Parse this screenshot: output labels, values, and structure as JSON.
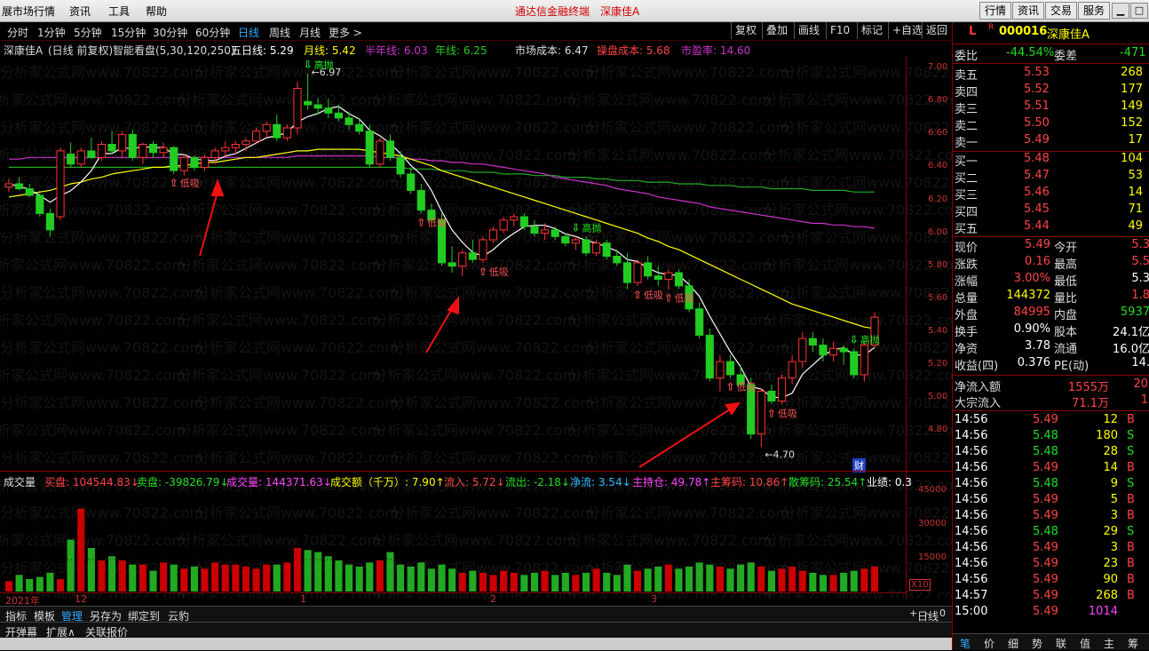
{
  "menubar": {
    "items": [
      "展市场行情",
      "资讯",
      "工具",
      "帮助"
    ],
    "title": "通达信金融终端",
    "stock_title": "深康佳A",
    "buttons": [
      "行情",
      "资讯",
      "交易",
      "服务"
    ],
    "window_controls": [
      "▁",
      "□",
      "✕"
    ]
  },
  "periodbar": {
    "periods": [
      "分时",
      "1分钟",
      "5分钟",
      "15分钟",
      "30分钟",
      "60分钟",
      "日线",
      "周线",
      "月线",
      "更多 >"
    ],
    "active": "日线",
    "tools": [
      "复权",
      "叠加",
      "画线",
      "F10",
      "标记",
      "+自选",
      "返回"
    ]
  },
  "infoline": {
    "name": "深康佳A",
    "mode": "(日线 前复权)",
    "indicator": "智能看盘(5,30,120,250)",
    "ma5": "五日线: 5.29",
    "ma_month": "月线: 5.42",
    "ma_halfyear": "半年线: 6.03",
    "ma_year": "年线: 6.25",
    "market_cost": "市场成本: 6.47",
    "op_cost": "操盘成本: 5.68",
    "pe": "市盈率: 14.60"
  },
  "colors": {
    "up": "#ff3333",
    "down": "#22cc22",
    "ma5": "#ffffff",
    "ma30": "#ffff00",
    "ma120": "#ee3322",
    "ma250": "#cc33cc",
    "market": "#22aa22"
  },
  "chart_data": {
    "type": "candlestick",
    "ylim": [
      4.6,
      7.05
    ],
    "y_ticks": [
      "7.00",
      "6.80",
      "6.60",
      "6.40",
      "6.20",
      "6.00",
      "5.80",
      "5.60",
      "5.40",
      "5.20",
      "5.00",
      "4.80"
    ],
    "candles": [
      [
        6.28,
        6.33,
        6.25,
        6.3
      ],
      [
        6.3,
        6.34,
        6.26,
        6.27
      ],
      [
        6.27,
        6.3,
        6.22,
        6.23
      ],
      [
        6.23,
        6.26,
        6.1,
        6.12
      ],
      [
        6.12,
        6.15,
        5.98,
        6.02
      ],
      [
        6.1,
        6.52,
        6.08,
        6.5
      ],
      [
        6.48,
        6.55,
        6.4,
        6.42
      ],
      [
        6.42,
        6.52,
        6.4,
        6.5
      ],
      [
        6.5,
        6.58,
        6.45,
        6.46
      ],
      [
        6.46,
        6.56,
        6.44,
        6.54
      ],
      [
        6.54,
        6.62,
        6.48,
        6.5
      ],
      [
        6.5,
        6.62,
        6.46,
        6.6
      ],
      [
        6.6,
        6.63,
        6.44,
        6.46
      ],
      [
        6.46,
        6.55,
        6.42,
        6.54
      ],
      [
        6.54,
        6.56,
        6.46,
        6.49
      ],
      [
        6.49,
        6.55,
        6.46,
        6.52
      ],
      [
        6.52,
        6.53,
        6.36,
        6.38
      ],
      [
        6.38,
        6.48,
        6.35,
        6.46
      ],
      [
        6.46,
        6.47,
        6.38,
        6.4
      ],
      [
        6.4,
        6.48,
        6.38,
        6.46
      ],
      [
        6.46,
        6.52,
        6.42,
        6.5
      ],
      [
        6.5,
        6.56,
        6.46,
        6.52
      ],
      [
        6.52,
        6.56,
        6.48,
        6.54
      ],
      [
        6.54,
        6.58,
        6.5,
        6.56
      ],
      [
        6.56,
        6.64,
        6.54,
        6.62
      ],
      [
        6.62,
        6.68,
        6.58,
        6.66
      ],
      [
        6.66,
        6.72,
        6.56,
        6.58
      ],
      [
        6.58,
        6.66,
        6.56,
        6.64
      ],
      [
        6.64,
        6.92,
        6.6,
        6.88
      ],
      [
        6.8,
        6.97,
        6.75,
        6.78
      ],
      [
        6.78,
        6.82,
        6.72,
        6.76
      ],
      [
        6.76,
        6.82,
        6.7,
        6.73
      ],
      [
        6.73,
        6.78,
        6.68,
        6.7
      ],
      [
        6.7,
        6.74,
        6.63,
        6.66
      ],
      [
        6.66,
        6.7,
        6.6,
        6.62
      ],
      [
        6.62,
        6.66,
        6.4,
        6.42
      ],
      [
        6.42,
        6.58,
        6.4,
        6.56
      ],
      [
        6.56,
        6.6,
        6.44,
        6.46
      ],
      [
        6.46,
        6.5,
        6.34,
        6.36
      ],
      [
        6.36,
        6.4,
        6.24,
        6.26
      ],
      [
        6.26,
        6.3,
        6.12,
        6.14
      ],
      [
        6.14,
        6.18,
        6.06,
        6.08
      ],
      [
        6.08,
        6.12,
        5.8,
        5.82
      ],
      [
        5.82,
        5.92,
        5.76,
        5.8
      ],
      [
        5.8,
        5.9,
        5.74,
        5.88
      ],
      [
        5.88,
        5.96,
        5.82,
        5.84
      ],
      [
        5.84,
        5.98,
        5.82,
        5.96
      ],
      [
        5.96,
        6.04,
        5.94,
        6.02
      ],
      [
        6.02,
        6.1,
        6.0,
        6.08
      ],
      [
        6.08,
        6.12,
        6.04,
        6.1
      ],
      [
        6.1,
        6.12,
        6.02,
        6.04
      ],
      [
        6.04,
        6.08,
        5.98,
        6.0
      ],
      [
        6.0,
        6.06,
        5.96,
        6.02
      ],
      [
        6.02,
        6.04,
        5.96,
        5.98
      ],
      [
        5.98,
        6.0,
        5.92,
        5.94
      ],
      [
        5.94,
        5.98,
        5.9,
        5.96
      ],
      [
        5.96,
        5.98,
        5.86,
        5.88
      ],
      [
        5.88,
        5.96,
        5.86,
        5.94
      ],
      [
        5.94,
        5.96,
        5.84,
        5.86
      ],
      [
        5.86,
        5.9,
        5.8,
        5.82
      ],
      [
        5.82,
        5.88,
        5.66,
        5.7
      ],
      [
        5.7,
        5.84,
        5.68,
        5.82
      ],
      [
        5.82,
        5.86,
        5.72,
        5.74
      ],
      [
        5.74,
        5.8,
        5.68,
        5.72
      ],
      [
        5.72,
        5.78,
        5.66,
        5.76
      ],
      [
        5.76,
        5.78,
        5.66,
        5.68
      ],
      [
        5.68,
        5.72,
        5.52,
        5.54
      ],
      [
        5.54,
        5.58,
        5.36,
        5.38
      ],
      [
        5.38,
        5.42,
        5.1,
        5.12
      ],
      [
        5.12,
        5.26,
        5.04,
        5.22
      ],
      [
        5.22,
        5.26,
        5.12,
        5.14
      ],
      [
        5.14,
        5.2,
        5.06,
        5.08
      ],
      [
        5.08,
        5.12,
        4.75,
        4.78
      ],
      [
        4.78,
        5.06,
        4.7,
        5.04
      ],
      [
        5.04,
        5.08,
        4.96,
        4.98
      ],
      [
        4.98,
        5.14,
        4.96,
        5.12
      ],
      [
        5.12,
        5.26,
        5.08,
        5.22
      ],
      [
        5.22,
        5.4,
        5.18,
        5.36
      ],
      [
        5.36,
        5.4,
        5.28,
        5.32
      ],
      [
        5.32,
        5.36,
        5.22,
        5.26
      ],
      [
        5.26,
        5.34,
        5.22,
        5.3
      ],
      [
        5.3,
        5.32,
        5.2,
        5.28
      ],
      [
        5.28,
        5.3,
        5.12,
        5.14
      ],
      [
        5.14,
        5.34,
        5.1,
        5.32
      ],
      [
        5.32,
        5.52,
        5.3,
        5.49
      ]
    ],
    "ma_month": [
      6.22,
      6.23,
      6.24,
      6.25,
      6.26,
      6.28,
      6.3,
      6.31,
      6.33,
      6.34,
      6.36,
      6.37,
      6.38,
      6.39,
      6.4,
      6.4,
      6.41,
      6.41,
      6.42,
      6.43,
      6.43,
      6.44,
      6.45,
      6.46,
      6.46,
      6.47,
      6.48,
      6.49,
      6.5,
      6.5,
      6.51,
      6.51,
      6.51,
      6.51,
      6.51,
      6.5,
      6.49,
      6.48,
      6.47,
      6.45,
      6.43,
      6.41,
      6.38,
      6.36,
      6.34,
      6.32,
      6.3,
      6.28,
      6.26,
      6.24,
      6.22,
      6.2,
      6.18,
      6.16,
      6.14,
      6.12,
      6.1,
      6.08,
      6.06,
      6.04,
      6.02,
      6.0,
      5.97,
      5.95,
      5.92,
      5.9,
      5.87,
      5.84,
      5.81,
      5.78,
      5.75,
      5.72,
      5.69,
      5.66,
      5.63,
      5.6,
      5.57,
      5.55,
      5.53,
      5.51,
      5.49,
      5.47,
      5.45,
      5.43,
      5.42
    ],
    "ma_halfyear": [
      6.45,
      6.45,
      6.46,
      6.46,
      6.46,
      6.46,
      6.46,
      6.46,
      6.46,
      6.46,
      6.46,
      6.46,
      6.46,
      6.46,
      6.46,
      6.46,
      6.46,
      6.46,
      6.46,
      6.46,
      6.46,
      6.46,
      6.46,
      6.46,
      6.46,
      6.46,
      6.46,
      6.46,
      6.47,
      6.47,
      6.47,
      6.47,
      6.47,
      6.47,
      6.47,
      6.47,
      6.46,
      6.46,
      6.46,
      6.45,
      6.45,
      6.44,
      6.44,
      6.43,
      6.43,
      6.42,
      6.42,
      6.41,
      6.4,
      6.39,
      6.38,
      6.37,
      6.36,
      6.34,
      6.33,
      6.32,
      6.31,
      6.3,
      6.29,
      6.27,
      6.26,
      6.25,
      6.24,
      6.22,
      6.21,
      6.2,
      6.19,
      6.18,
      6.16,
      6.15,
      6.14,
      6.13,
      6.12,
      6.11,
      6.1,
      6.09,
      6.08,
      6.07,
      6.06,
      6.06,
      6.05,
      6.05,
      6.04,
      6.04,
      6.03
    ],
    "ma_year": [
      6.4,
      6.4,
      6.4,
      6.4,
      6.4,
      6.4,
      6.4,
      6.4,
      6.4,
      6.4,
      6.4,
      6.4,
      6.4,
      6.4,
      6.4,
      6.4,
      6.4,
      6.4,
      6.4,
      6.4,
      6.4,
      6.4,
      6.4,
      6.4,
      6.4,
      6.4,
      6.4,
      6.4,
      6.4,
      6.4,
      6.4,
      6.4,
      6.4,
      6.4,
      6.4,
      6.4,
      6.4,
      6.4,
      6.4,
      6.39,
      6.39,
      6.39,
      6.38,
      6.38,
      6.38,
      6.37,
      6.37,
      6.37,
      6.36,
      6.36,
      6.36,
      6.35,
      6.35,
      6.35,
      6.34,
      6.34,
      6.34,
      6.33,
      6.33,
      6.32,
      6.32,
      6.32,
      6.31,
      6.31,
      6.31,
      6.3,
      6.3,
      6.3,
      6.29,
      6.29,
      6.29,
      6.28,
      6.28,
      6.28,
      6.27,
      6.27,
      6.27,
      6.27,
      6.26,
      6.26,
      6.26,
      6.26,
      6.25,
      6.25,
      6.25
    ],
    "volumes": [
      5,
      8,
      6,
      7,
      9,
      6,
      25,
      40,
      21,
      15,
      17,
      15,
      13,
      13,
      10,
      14,
      13,
      11,
      12,
      11,
      14,
      13,
      13,
      12,
      11,
      13,
      13,
      14,
      21,
      20,
      19,
      17,
      15,
      13,
      12,
      14,
      15,
      19,
      13,
      12,
      14,
      11,
      13,
      11,
      9,
      10,
      9,
      8,
      10,
      9,
      8,
      9,
      10,
      8,
      9,
      8,
      9,
      11,
      9,
      8,
      13,
      10,
      11,
      12,
      13,
      11,
      12,
      14,
      13,
      12,
      11,
      13,
      14,
      12,
      10,
      11,
      12,
      10,
      9,
      8,
      8,
      9,
      10,
      11,
      12
    ],
    "price_labels": {
      "high": "6.97",
      "low": "4.70"
    },
    "signals": [
      {
        "type": "低吸",
        "i": 16
      },
      {
        "type": "高抛",
        "i": 29
      },
      {
        "type": "低吸",
        "i": 40
      },
      {
        "type": "低吸",
        "i": 46
      },
      {
        "type": "高抛",
        "i": 55
      },
      {
        "type": "低吸",
        "i": 61
      },
      {
        "type": "低吸",
        "i": 64
      },
      {
        "type": "低吸",
        "i": 70
      },
      {
        "type": "低吸",
        "i": 74
      },
      {
        "type": "高抛",
        "i": 82
      }
    ],
    "vol_ticks": [
      "45000",
      "30000",
      "15000",
      "X10"
    ],
    "x_dates": [
      "2021年",
      "12",
      "1",
      "2",
      "3"
    ]
  },
  "volinfo": {
    "title": "成交量",
    "buy": "买盘: 104544.83↓",
    "sell": "卖盘: -39826.79↓",
    "volume": "成交量: 144371.63↓",
    "amount": "成交额（千万）: 7.90↑",
    "inflow": "流入: 5.72↓",
    "outflow": "流出: -2.18↓",
    "net": "净流: 3.54↓",
    "main_pos": "主持仓: 49.78↑",
    "main_chip": "主筹码: 10.86↑",
    "retail_chip": "散筹码: 25.54↑",
    "perf": "业绩: 0.3"
  },
  "bottom1": {
    "items": [
      "指标",
      "模板",
      "管理",
      "另存为",
      "绑定到",
      "云豹"
    ],
    "active": "管理",
    "right": [
      "日线",
      "+",
      "-",
      "0"
    ]
  },
  "bottom2": {
    "items": [
      "开弹幕",
      "扩展∧",
      "关联报价"
    ]
  },
  "rpanel": {
    "code": "000016",
    "name": "深康佳A",
    "flag_l": "L",
    "flag_r": "R",
    "weibi_label": "委比",
    "weibi": "-44.54%",
    "weicha_label": "委差",
    "weicha": "-471",
    "sell": [
      {
        "label": "卖五",
        "price": "5.53",
        "vol": "268"
      },
      {
        "label": "卖四",
        "price": "5.52",
        "vol": "177"
      },
      {
        "label": "卖三",
        "price": "5.51",
        "vol": "149"
      },
      {
        "label": "卖二",
        "price": "5.50",
        "vol": "152"
      },
      {
        "label": "卖一",
        "price": "5.49",
        "vol": "17"
      }
    ],
    "buy": [
      {
        "label": "买一",
        "price": "5.48",
        "vol": "104"
      },
      {
        "label": "买二",
        "price": "5.47",
        "vol": "53"
      },
      {
        "label": "买三",
        "price": "5.46",
        "vol": "14"
      },
      {
        "label": "买四",
        "price": "5.45",
        "vol": "71"
      },
      {
        "label": "买五",
        "price": "5.44",
        "vol": "49"
      }
    ],
    "stats": [
      {
        "l1": "现价",
        "v1": "5.49",
        "l2": "今开",
        "v2": "5.3",
        "c1": "up",
        "c2": "up"
      },
      {
        "l1": "涨跌",
        "v1": "0.16",
        "l2": "最高",
        "v2": "5.5",
        "c1": "up",
        "c2": "up"
      },
      {
        "l1": "涨幅",
        "v1": "3.00%",
        "l2": "最低",
        "v2": "5.3",
        "c1": "up",
        "c2": "wht"
      },
      {
        "l1": "总量",
        "v1": "144372",
        "l2": "量比",
        "v2": "1.8",
        "c1": "yel",
        "c2": "up"
      },
      {
        "l1": "外盘",
        "v1": "84995",
        "l2": "内盘",
        "v2": "5937",
        "c1": "up",
        "c2": "dn"
      },
      {
        "l1": "换手",
        "v1": "0.90%",
        "l2": "股本",
        "v2": "24.1亿",
        "c1": "wht",
        "c2": "wht"
      },
      {
        "l1": "净资",
        "v1": "3.78",
        "l2": "流通",
        "v2": "16.0亿",
        "c1": "wht",
        "c2": "wht"
      },
      {
        "l1": "收益(四)",
        "v1": "0.376",
        "l2": "PE(动)",
        "v2": "14.",
        "c1": "wht",
        "c2": "wht"
      }
    ],
    "flow": [
      {
        "l": "净流入额",
        "v": "1555万",
        "v2": "20"
      },
      {
        "l": "大宗流入",
        "v": "71.1万",
        "v2": "1"
      }
    ],
    "ticks": [
      {
        "t": "14:56",
        "p": "5.49",
        "v": "12",
        "s": "B"
      },
      {
        "t": "14:56",
        "p": "5.48",
        "v": "180",
        "s": "S"
      },
      {
        "t": "14:56",
        "p": "5.48",
        "v": "28",
        "s": "S"
      },
      {
        "t": "14:56",
        "p": "5.49",
        "v": "14",
        "s": "B"
      },
      {
        "t": "14:56",
        "p": "5.48",
        "v": "9",
        "s": "S"
      },
      {
        "t": "14:56",
        "p": "5.49",
        "v": "5",
        "s": "B"
      },
      {
        "t": "14:56",
        "p": "5.49",
        "v": "3",
        "s": "B"
      },
      {
        "t": "14:56",
        "p": "5.48",
        "v": "29",
        "s": "S"
      },
      {
        "t": "14:56",
        "p": "5.49",
        "v": "3",
        "s": "B"
      },
      {
        "t": "14:56",
        "p": "5.49",
        "v": "23",
        "s": "B"
      },
      {
        "t": "14:56",
        "p": "5.49",
        "v": "90",
        "s": "B"
      },
      {
        "t": "14:57",
        "p": "5.49",
        "v": "268",
        "s": "B"
      },
      {
        "t": "15:00",
        "p": "5.49",
        "v": "1014",
        "s": ""
      }
    ],
    "tabs": [
      "笔",
      "价",
      "细",
      "势",
      "联",
      "值",
      "主",
      "筹"
    ],
    "active_tab": "笔"
  },
  "watermark": "分析家公式网www.70822.com",
  "misc": {
    "cai_badge": "财"
  }
}
